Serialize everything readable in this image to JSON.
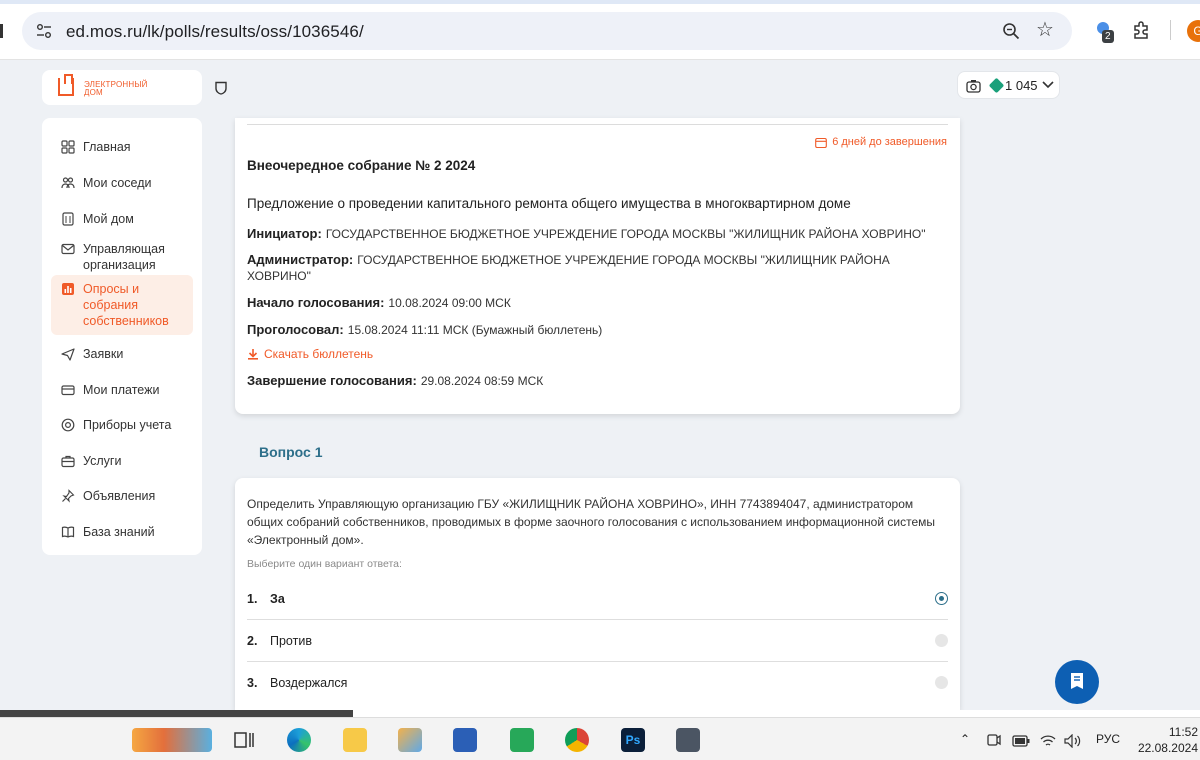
{
  "browser": {
    "url": "ed.mos.ru/lk/polls/results/oss/1036546/",
    "extension_badge": "2",
    "profile_letter": "G"
  },
  "logo": {
    "text": "ЭЛЕКТРОННЫЙ ДОМ"
  },
  "points": {
    "value": "1 045"
  },
  "sidebar": {
    "items": [
      {
        "label": "Главная",
        "icon": "grid-icon"
      },
      {
        "label": "Мои соседи",
        "icon": "people-icon"
      },
      {
        "label": "Мой дом",
        "icon": "building-icon"
      },
      {
        "label": "Управляющая организация",
        "icon": "mail-icon"
      },
      {
        "label": "Опросы и собрания собственников",
        "icon": "poll-icon",
        "active": true
      },
      {
        "label": "Заявки",
        "icon": "send-icon"
      },
      {
        "label": "Мои платежи",
        "icon": "card-icon"
      },
      {
        "label": "Приборы учета",
        "icon": "meter-icon"
      },
      {
        "label": "Услуги",
        "icon": "briefcase-icon"
      },
      {
        "label": "Объявления",
        "icon": "pin-icon"
      },
      {
        "label": "База знаний",
        "icon": "book-icon"
      }
    ]
  },
  "meeting": {
    "deadline": "6 дней до завершения",
    "title": "Внеочередное собрание № 2 2024",
    "proposal": "Предложение о проведении капитального ремонта общего имущества в многоквартирном доме",
    "initiator_key": "Инициатор:",
    "initiator_value": "ГОСУДАРСТВЕННОЕ БЮДЖЕТНОЕ УЧРЕЖДЕНИЕ ГОРОДА МОСКВЫ \"ЖИЛИЩНИК РАЙОНА ХОВРИНО\"",
    "admin_key": "Администратор:",
    "admin_value": "ГОСУДАРСТВЕННОЕ БЮДЖЕТНОЕ УЧРЕЖДЕНИЕ ГОРОДА МОСКВЫ \"ЖИЛИЩНИК РАЙОНА ХОВРИНО\"",
    "start_key": "Начало голосования:",
    "start_value": "10.08.2024 09:00 МСК",
    "voted_key": "Проголосовал:",
    "voted_value": "15.08.2024 11:11 МСК (Бумажный бюллетень)",
    "download_label": "Скачать бюллетень",
    "end_key": "Завершение голосования:",
    "end_value": "29.08.2024 08:59 МСК"
  },
  "question": {
    "heading": "Вопрос 1",
    "text": "Определить Управляющую организацию ГБУ «ЖИЛИЩНИК РАЙОНА ХОВРИНО», ИНН 7743894047, администратором общих собраний собственников, проводимых в форме заочного голосования с использованием информационной системы «Электронный дом».",
    "hint": "Выберите один вариант ответа:",
    "options": [
      {
        "num": "1.",
        "label": "За",
        "selected": true
      },
      {
        "num": "2.",
        "label": "Против",
        "selected": false
      },
      {
        "num": "3.",
        "label": "Воздержался",
        "selected": false
      }
    ]
  },
  "taskbar": {
    "language": "РУС",
    "time": "11:52",
    "date": "22.08.2024"
  },
  "colors": {
    "accent_orange": "#f05a28",
    "teal": "#2d6f8a",
    "chat_blue": "#0d5fb3"
  }
}
